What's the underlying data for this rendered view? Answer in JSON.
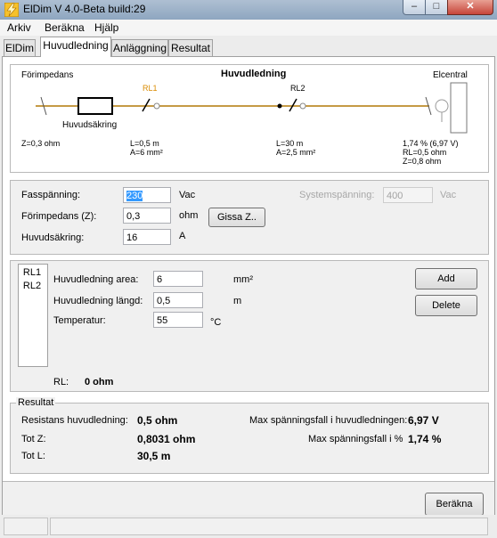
{
  "window": {
    "title": "ElDim V 4.0-Beta build:29"
  },
  "menu": [
    "Arkiv",
    "Beräkna",
    "Hjälp"
  ],
  "tabs": [
    "ElDim",
    "Huvudledning",
    "Anläggning",
    "Resultat"
  ],
  "diagram": {
    "title": "Huvudledning",
    "forimpedans_label": "Förimpedans",
    "forimpedans_value": "Z=0,3 ohm",
    "huvudsakring_label": "Huvudsäkring",
    "rl1": {
      "name": "RL1",
      "length": "L=0,5 m",
      "area": "A=6 mm²"
    },
    "rl2": {
      "name": "RL2",
      "length": "L=30 m",
      "area": "A=2,5 mm²"
    },
    "elcentral_label": "Elcentral",
    "elcentral_drop": "1,74 % (6,97 V)",
    "elcentral_rl": "RL=0,5 ohm",
    "elcentral_z": "Z=0,8 ohm"
  },
  "supply": {
    "fasspanning_label": "Fasspänning:",
    "fasspanning_value": "230",
    "fasspanning_unit": "Vac",
    "systemspanning_label": "Systemspänning:",
    "systemspanning_value": "400",
    "systemspanning_unit": "Vac",
    "forimpedans_label": "Förimpedans (Z):",
    "forimpedans_value": "0,3",
    "forimpedans_unit": "ohm",
    "gissa_label": "Gissa Z..",
    "huvudsakring_label": "Huvudsäkring:",
    "huvudsakring_value": "16",
    "huvudsakring_unit": "A"
  },
  "line": {
    "list": [
      "RL1",
      "RL2"
    ],
    "area_label": "Huvudledning area:",
    "area_value": "6",
    "area_unit": "mm²",
    "length_label": "Huvudledning längd:",
    "length_value": "0,5",
    "length_unit": "m",
    "temp_label": "Temperatur:",
    "temp_value": "55",
    "temp_unit": "°C",
    "add_label": "Add",
    "delete_label": "Delete",
    "rl_label": "RL:",
    "rl_value": "0 ohm"
  },
  "result": {
    "group_label": "Resultat",
    "resistans_label": "Resistans huvudledning:",
    "resistans_value": "0,5 ohm",
    "totz_label": "Tot Z:",
    "totz_value": "0,8031 ohm",
    "totl_label": "Tot L:",
    "totl_value": "30,5 m",
    "maxfall_v_label": "Max spänningsfall i huvudledningen:",
    "maxfall_v_value": "6,97 V",
    "maxfall_pct_label": "Max spänningsfall i %",
    "maxfall_pct_value": "1,74 %"
  },
  "berakna_label": "Beräkna"
}
